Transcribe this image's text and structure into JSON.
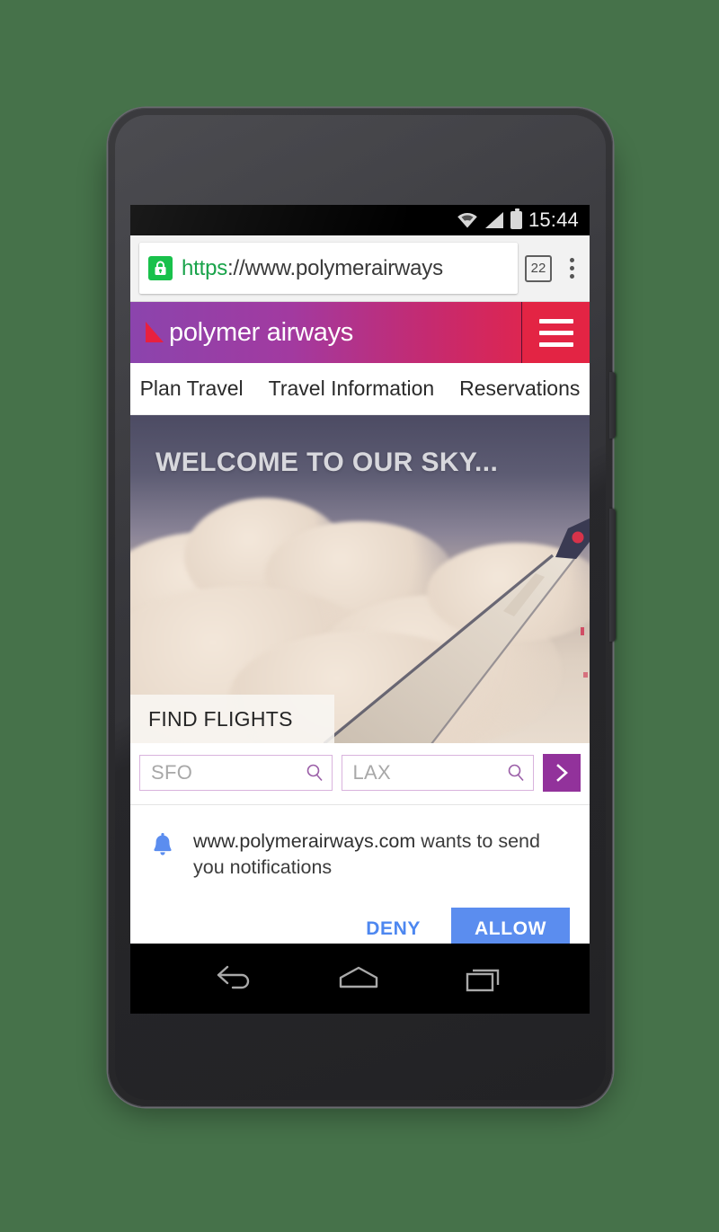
{
  "background_color": "#46724a",
  "device": {
    "name": "android-phone",
    "camera_icon": "camera-icon",
    "speaker_top_icon": "speaker-grille-icon",
    "speaker_bottom_icon": "speaker-grille-icon",
    "power_button": "power-button",
    "volume_button": "volume-button"
  },
  "status_bar": {
    "wifi_icon": "wifi-icon",
    "signal_icon": "cellular-signal-icon",
    "battery_icon": "battery-full-icon",
    "time": "15:44"
  },
  "browser": {
    "security_icon": "lock-icon",
    "security_color": "#19c14b",
    "url_scheme": "https",
    "url_separator": "://",
    "url_host": "www.polymerairways",
    "tab_count": "22",
    "tab_count_icon": "tab-switcher-icon",
    "menu_icon": "overflow-menu-icon"
  },
  "site": {
    "header": {
      "logo_icon": "polymer-airways-triangle-logo",
      "logo_color": "#e8203f",
      "brand": "polymer airways",
      "gradient_from": "#8b44ad",
      "gradient_to": "#e62745",
      "menu_icon": "hamburger-menu-icon",
      "menu_bg": "#e32444"
    },
    "nav": [
      {
        "label": "Plan Travel"
      },
      {
        "label": "Travel Information"
      },
      {
        "label": "Reservations"
      }
    ],
    "hero": {
      "title": "WELCOME TO OUR SKY...",
      "image_alt": "airplane-wing-above-clouds",
      "tab_label": "FIND FLIGHTS"
    },
    "search": {
      "origin_placeholder": "SFO",
      "destination_placeholder": "LAX",
      "origin_value": "",
      "destination_value": "",
      "search_icon": "magnifier-icon",
      "submit_icon": "chevron-right-icon",
      "submit_color": "#92329b",
      "field_border_color": "#d9b3dd"
    }
  },
  "notification_prompt": {
    "icon": "bell-icon",
    "icon_color": "#5b8def",
    "origin": "www.polymerairways.com",
    "message": " wants to send you notifications",
    "deny_label": "DENY",
    "allow_label": "ALLOW",
    "deny_color": "#4d87f0",
    "allow_bg": "#5b8def"
  },
  "android_nav": {
    "back_icon": "back-arrow-icon",
    "home_icon": "home-icon",
    "recents_icon": "recent-apps-icon"
  }
}
